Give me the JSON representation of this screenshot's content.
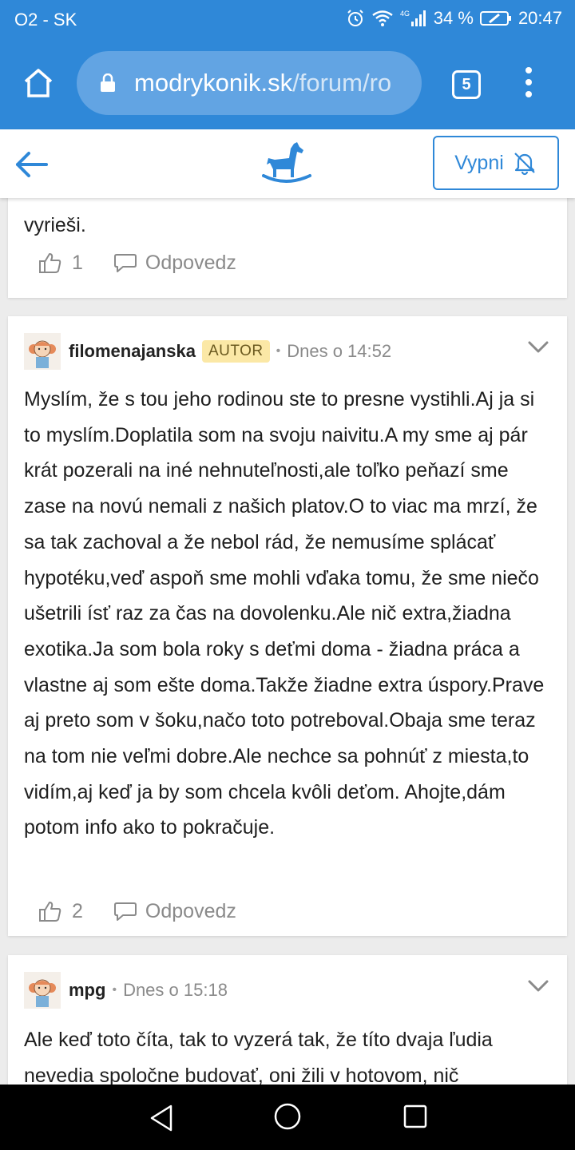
{
  "status_bar": {
    "carrier": "O2 - SK",
    "battery": "34 %",
    "time": "20:47",
    "network": "4G"
  },
  "browser": {
    "url_domain": "modrykonik.sk",
    "url_path": "/forum/ro",
    "tab_count": "5"
  },
  "header": {
    "vypni_label": "Vypni"
  },
  "posts": [
    {
      "text_tail": "vyrieši.",
      "likes": "1",
      "reply_label": "Odpovedz"
    },
    {
      "username": "filomenajanska",
      "badge": "AUTOR",
      "time": "Dnes o 14:52",
      "text": "Myslím, že s tou jeho rodinou ste to presne vystihli.Aj ja si to myslím.Doplatila som na svoju naivitu.A my sme aj pár krát pozerali na iné nehnuteľnosti,ale toľko peňazí sme zase na novú nemali z našich platov.O to viac ma mrzí, že sa tak zachoval a že nebol rád, že nemusíme splácať hypotéku,veď aspoň sme mohli vďaka tomu, že sme niečo ušetrili ísť raz za čas na dovolenku.Ale nič extra,žiadna exotika.Ja som bola roky s deťmi doma - žiadna práca a vlastne aj som ešte doma.Takže žiadne extra úspory.Prave aj preto som v šoku,načo toto potreboval.Obaja sme teraz na tom nie veľmi dobre.Ale nechce sa pohnúť z miesta,to vidím,aj keď ja by som chcela kvôli deťom. Ahojte,dám potom info ako to pokračuje.",
      "likes": "2",
      "reply_label": "Odpovedz"
    },
    {
      "username": "mpg",
      "time": "Dnes o 15:18",
      "text": "Ale keď toto číta, tak to vyzerá tak, že títo dvaja ľudia nevedia spoločne budovať, oni žili v hotovom, nič"
    }
  ],
  "colors": {
    "brand_blue": "#2f88d8",
    "badge_bg": "#fbe8a6",
    "muted": "#8a8a8a"
  }
}
